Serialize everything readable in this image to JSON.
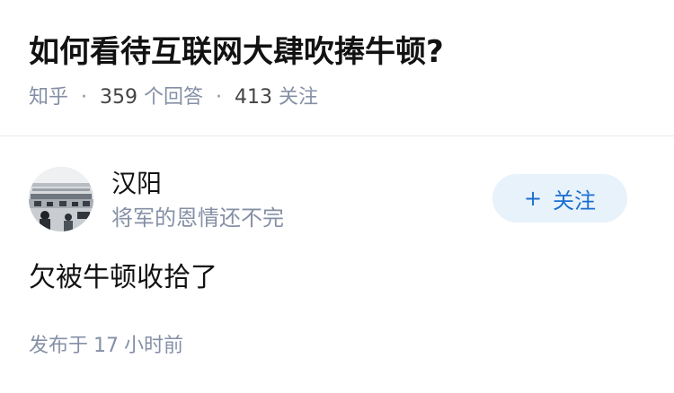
{
  "question": {
    "title": "如何看待互联网大肆吹捧牛顿?",
    "source": "知乎",
    "separator": "·",
    "answer_count": "359",
    "answer_label": "个回答",
    "follower_count": "413",
    "follower_label": "关注"
  },
  "answer": {
    "author": {
      "name": "汉阳",
      "bio": "将军的恩情还不完",
      "avatar_icon": "office-photo-avatar"
    },
    "follow_button": {
      "icon": "plus-icon",
      "plus": "+",
      "label": "关注"
    },
    "content": "欠被牛顿收拾了",
    "publish": {
      "prefix": "发布于",
      "amount": "17",
      "suffix": "小时前"
    }
  },
  "colors": {
    "title": "#121212",
    "meta": "#8590a6",
    "follow_bg": "#e8f2fb",
    "follow_text": "#1a6fd0",
    "divider": "#ebebeb"
  }
}
